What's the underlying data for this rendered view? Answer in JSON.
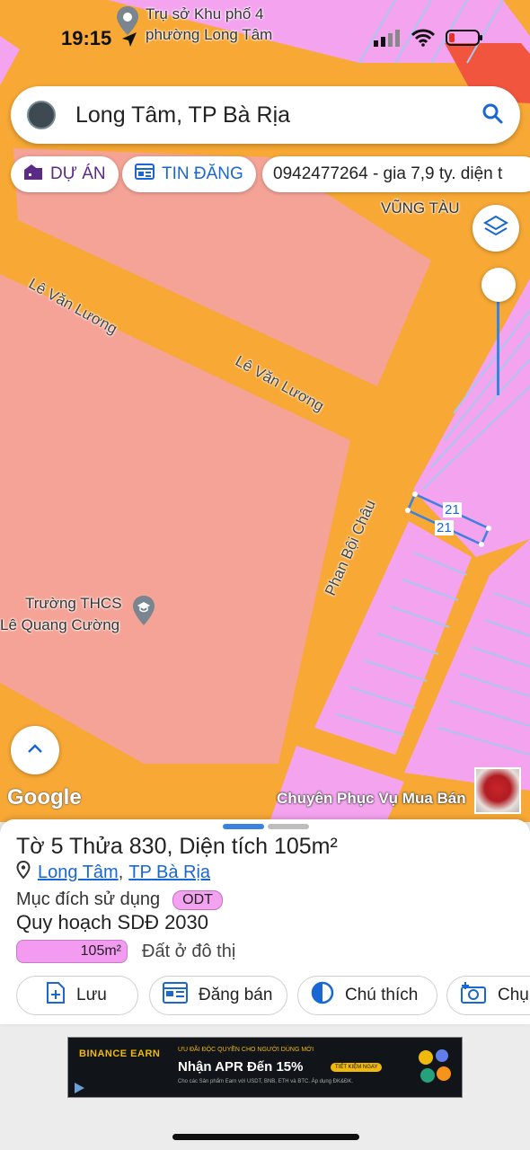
{
  "status_bar": {
    "time": "19:15"
  },
  "map": {
    "poi_top": {
      "line1": "Trụ sở Khu phố 4",
      "line2": "phường Long Tâm"
    },
    "poi_right": "VŨNG TÀU",
    "streets": [
      "Lê Văn Lương",
      "Lê Văn Lương",
      "Phan Bội Châu"
    ],
    "school": {
      "line1": "Trường THCS",
      "line2": "Lê Quang Cường"
    },
    "parcel_numbers": [
      "21",
      "21"
    ],
    "overlay_text": "Chuyên Phục Vụ Mua Bán",
    "google_logo": "Google",
    "colors": {
      "road": "#f7a835",
      "residential_land": "#f4a3ef",
      "public_land": "#f4a396",
      "selection": "#3b82e0"
    }
  },
  "search": {
    "text": "Long Tâm, TP Bà Rịa",
    "icon": "search-icon"
  },
  "chips": [
    {
      "label": "DỰ ÁN",
      "icon": "building-icon"
    },
    {
      "label": "TIN ĐĂNG",
      "icon": "listing-icon"
    },
    {
      "label": "0942477264 - gia 7,9 ty. diện t",
      "icon": "none"
    }
  ],
  "sheet": {
    "title": "Tờ 5 Thửa 830, Diện tích 105m²",
    "ward": "Long Tâm",
    "separator": ",",
    "city": "TP Bà Rịa",
    "purpose_label": "Mục đích sử dụng",
    "purpose_code": "ODT",
    "plan_label": "Quy hoạch SDĐ 2030",
    "area_value": "105m²",
    "area_type": "Đất ở đô thị",
    "actions": [
      {
        "label": "Lưu",
        "icon": "save-icon"
      },
      {
        "label": "Đăng bán",
        "icon": "sell-icon"
      },
      {
        "label": "Chú thích",
        "icon": "legend-icon"
      },
      {
        "label": "Chụ",
        "icon": "camera-icon"
      }
    ]
  },
  "ad": {
    "brand": "BINANCE EARN",
    "tagline": "ƯU ĐÃI ĐỘC QUYỀN CHO NGƯỜI DÙNG MỚI",
    "headline": "Nhận APR Đến 15%",
    "cta": "TIẾT KIỆM NGAY",
    "fineprint": "Cho các Sản phẩm Earn với USDT, BNB, ETH và BTC. Áp dụng ĐK&ĐK."
  }
}
